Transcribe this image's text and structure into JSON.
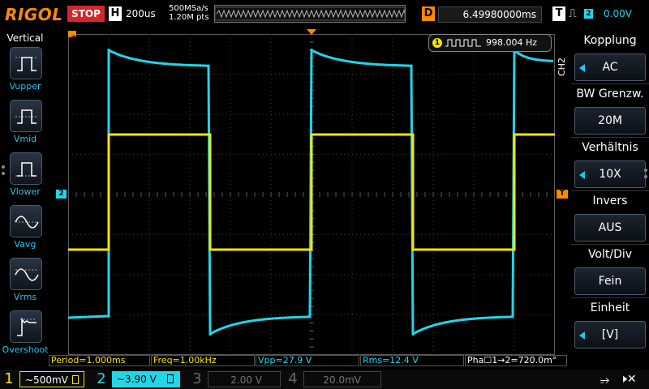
{
  "topbar": {
    "brand": "RIGOL",
    "run_state": "STOP",
    "timebase_letter": "H",
    "timebase": "200us",
    "sample_rate": "500MSa/s",
    "mem_points": "1.20M pts",
    "delay_letter": "D",
    "delay": "6.49980000ms",
    "trigger_letter": "T",
    "trigger_source": "2",
    "trigger_level": "0.00V"
  },
  "left_menu": {
    "title": "Vertical",
    "items": [
      {
        "label": "Vupper",
        "icon": "vupper-icon"
      },
      {
        "label": "Vmid",
        "icon": "vmid-icon"
      },
      {
        "label": "Vlower",
        "icon": "vlower-icon"
      },
      {
        "label": "Vavg",
        "icon": "vavg-icon"
      },
      {
        "label": "Vrms",
        "icon": "vrms-icon"
      },
      {
        "label": "Overshoot",
        "icon": "overshoot-icon"
      }
    ]
  },
  "freq_counter": {
    "channel": "1",
    "value": "998.004 Hz"
  },
  "markers": {
    "trigger_time": "T",
    "ch2_ground": "2",
    "ch1_level": "T"
  },
  "right_menu": {
    "channel_tag": "CH2",
    "items": [
      {
        "title": "Kopplung",
        "value": "AC",
        "arrow": true
      },
      {
        "title": "BW Grenzw.",
        "value": "20M",
        "arrow": false
      },
      {
        "title": "Verhältnis",
        "value": "10X",
        "arrow": true
      },
      {
        "title": "Invers",
        "value": "AUS",
        "arrow": false
      },
      {
        "title": "Volt/Div",
        "value": "Fein",
        "arrow": false
      },
      {
        "title": "Einheit",
        "value": "[V]",
        "arrow": true
      }
    ]
  },
  "measurements": [
    {
      "text": "Period=1.000ms",
      "color": "yellow"
    },
    {
      "text": "Freq=1.00kHz",
      "color": "yellow"
    },
    {
      "text": "Vpp=27.9 V",
      "color": "cyan"
    },
    {
      "text": "Rms=12.4 V",
      "color": "cyan"
    },
    {
      "text": "Pha☐1→2=720.0m°",
      "color": "white"
    }
  ],
  "channels": [
    {
      "num": "1",
      "scale": "~500mV",
      "color": "#f5e500",
      "active": true
    },
    {
      "num": "2",
      "scale": "~3.90 V",
      "color": "#21d6e7",
      "active": true,
      "selected": true
    },
    {
      "num": "3",
      "scale": "2.00 V",
      "color": "#666666",
      "active": false
    },
    {
      "num": "4",
      "scale": "20.0mV",
      "color": "#666666",
      "active": false
    }
  ],
  "colors": {
    "ch1": "#f5e500",
    "ch2": "#21d6e7",
    "accent": "#ff8a00",
    "stop": "#d4262c"
  }
}
